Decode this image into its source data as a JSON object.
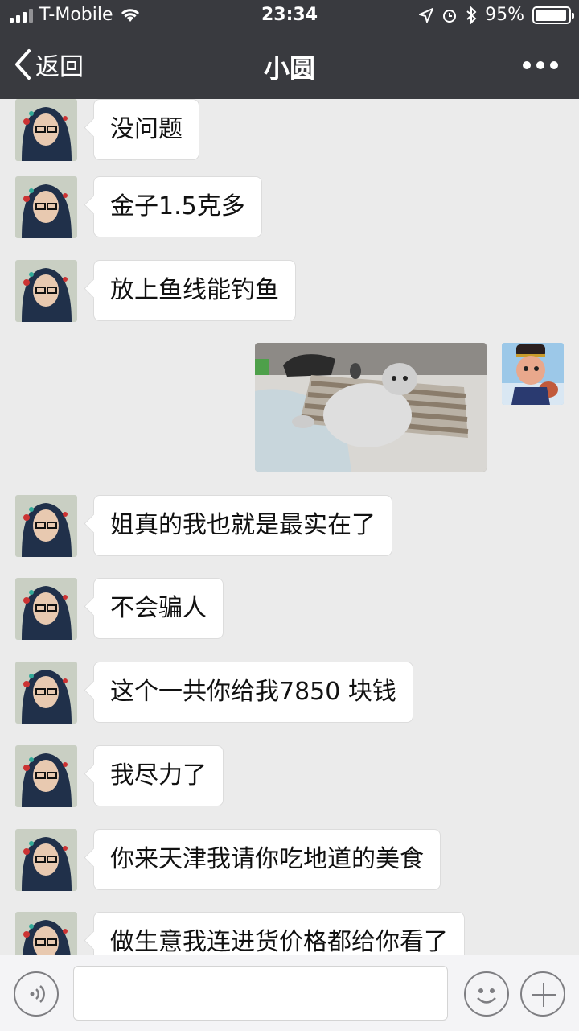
{
  "status_bar": {
    "carrier": "T-Mobile",
    "time": "23:34",
    "battery": "95%",
    "battery_level": 0.95
  },
  "nav": {
    "back_label": "返回",
    "title": "小圆"
  },
  "messages": [
    {
      "sender": "contact",
      "text": "没问题"
    },
    {
      "sender": "contact",
      "text": "金子1.5克多"
    },
    {
      "sender": "contact",
      "text": "放上鱼线能钓鱼"
    },
    {
      "sender": "me",
      "type": "image",
      "icon": "cat-photo"
    },
    {
      "sender": "contact",
      "text": "姐真的我也就是最实在了"
    },
    {
      "sender": "contact",
      "text": "不会骗人"
    },
    {
      "sender": "contact",
      "text": "这个一共你给我7850 块钱"
    },
    {
      "sender": "contact",
      "text": "我尽力了"
    },
    {
      "sender": "contact",
      "text": "你来天津我请你吃地道的美食"
    },
    {
      "sender": "contact",
      "text": "做生意我连进货价格都给你看了"
    }
  ],
  "input_bar": {
    "voice_icon": "voice-icon",
    "emoji_icon": "emoji-icon",
    "plus_icon": "plus-icon"
  },
  "colors": {
    "header": "#393a3f",
    "chat_bg": "#ebebeb",
    "bubble": "#ffffff"
  }
}
